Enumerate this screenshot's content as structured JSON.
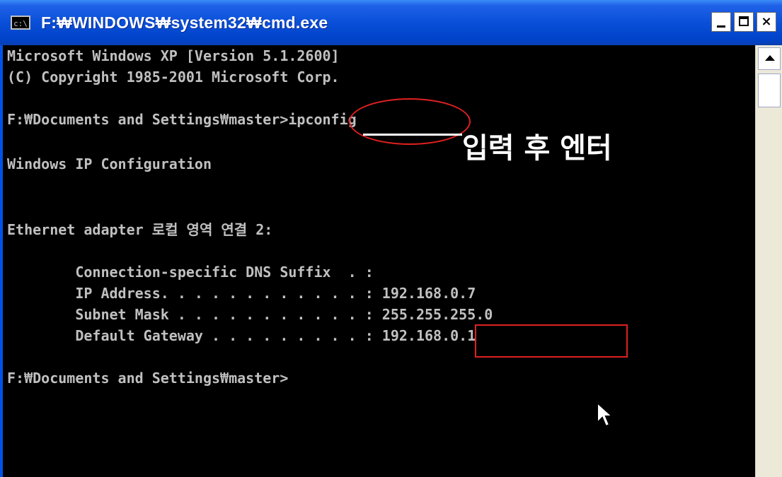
{
  "window": {
    "title": "F:₩WINDOWS₩system32₩cmd.exe",
    "icon_label": "c:\\",
    "buttons": {
      "minimize": "minimize",
      "maximize": "maximize",
      "close": "×"
    }
  },
  "console": {
    "lines": [
      "Microsoft Windows XP [Version 5.1.2600]",
      "(C) Copyright 1985-2001 Microsoft Corp.",
      "",
      "F:₩Documents and Settings₩master>ipconfig",
      "",
      "Windows IP Configuration",
      "",
      "",
      "Ethernet adapter 로컬 영역 연결 2:",
      "",
      "        Connection-specific DNS Suffix  . :",
      "        IP Address. . . . . . . . . . . . : 192.168.0.7",
      "        Subnet Mask . . . . . . . . . . . : 255.255.255.0",
      "        Default Gateway . . . . . . . . . : 192.168.0.1",
      "",
      "F:₩Documents and Settings₩master>"
    ]
  },
  "annotation": {
    "note": "입력 후 엔터"
  },
  "colors": {
    "titlebar": "#0a4fd8",
    "console_bg": "#000000",
    "console_text": "#c0c0c0",
    "highlight": "#e02020"
  }
}
